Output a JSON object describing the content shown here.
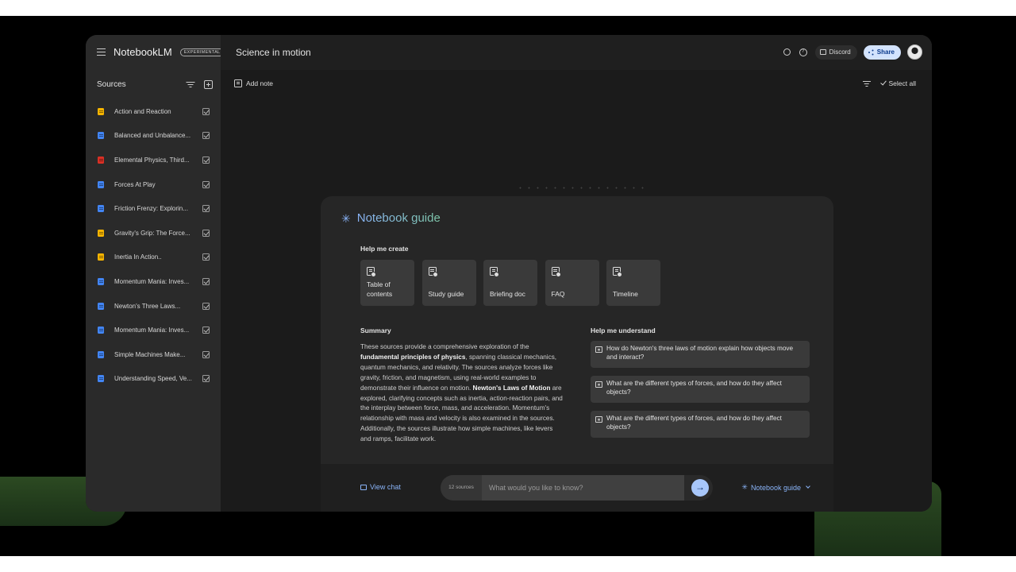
{
  "app": {
    "name": "NotebookLM",
    "badge": "EXPERIMENTAL"
  },
  "sidebar": {
    "title": "Sources",
    "items": [
      {
        "label": "Action and Reaction",
        "icon": "slides-icon",
        "color": "#f6b400",
        "checked": true
      },
      {
        "label": "Balanced and Unbalance...",
        "icon": "doc-icon",
        "color": "#4285f4",
        "checked": true
      },
      {
        "label": "Elemental Physics, Third...",
        "icon": "pdf-icon",
        "color": "#d93025",
        "checked": true
      },
      {
        "label": "Forces At Play",
        "icon": "doc-icon",
        "color": "#4285f4",
        "checked": true
      },
      {
        "label": "Friction Frenzy: Explorin...",
        "icon": "doc-icon",
        "color": "#4285f4",
        "checked": true
      },
      {
        "label": "Gravity's Grip: The Force...",
        "icon": "slides-icon",
        "color": "#f6b400",
        "checked": true
      },
      {
        "label": "Inertia In Action..",
        "icon": "slides-icon",
        "color": "#f6b400",
        "checked": true
      },
      {
        "label": "Momentum Mania: Inves...",
        "icon": "doc-icon",
        "color": "#4285f4",
        "checked": true
      },
      {
        "label": "Newton's Three Laws...",
        "icon": "doc-icon",
        "color": "#4285f4",
        "checked": true
      },
      {
        "label": "Momentum Mania: Inves...",
        "icon": "doc-icon",
        "color": "#4285f4",
        "checked": true
      },
      {
        "label": "Simple Machines Make...",
        "icon": "doc-icon",
        "color": "#4285f4",
        "checked": true
      },
      {
        "label": "Understanding Speed, Ve...",
        "icon": "doc-icon",
        "color": "#4285f4",
        "checked": true
      }
    ]
  },
  "header": {
    "title": "Science in motion",
    "discord_label": "Discord",
    "share_label": "Share"
  },
  "main": {
    "add_note_label": "Add note",
    "select_all_label": "Select all"
  },
  "guide": {
    "title": "Notebook guide",
    "create_label": "Help me create",
    "cards": [
      {
        "label": "Table of contents"
      },
      {
        "label": "Study guide"
      },
      {
        "label": "Briefing doc"
      },
      {
        "label": "FAQ"
      },
      {
        "label": "Timeline"
      }
    ],
    "summary_label": "Summary",
    "summary": {
      "p1": "These sources provide a comprehensive exploration of the ",
      "b1": "fundamental principles of physics",
      "p2": ", spanning classical mechanics, quantum mechanics, and relativity. The sources analyze forces like gravity, friction, and magnetism, using real-world examples to demonstrate their influence on motion. ",
      "b2": "Newton's Laws of Motion",
      "p3": " are explored, clarifying concepts such as inertia, action-reaction pairs, and the interplay between force, mass, and acceleration. Momentum's relationship with mass and velocity is also examined in the sources. Additionally, the sources illustrate how simple machines, like levers and ramps, facilitate work."
    },
    "understand_label": "Help me understand",
    "questions": [
      {
        "text": "How do Newton's three laws of motion explain how objects move and interact?"
      },
      {
        "text": "What are the different types of forces, and how do they affect objects?"
      },
      {
        "text": "What are the different types of forces, and how do they affect objects?"
      }
    ]
  },
  "footer": {
    "view_chat_label": "View chat",
    "sources_count": "12 sources",
    "input_placeholder": "What would you like to know?",
    "guide_toggle_label": "Notebook guide"
  },
  "colors": {
    "accent": "#8ab4f8",
    "share_bg": "#d3e3fd",
    "send_bg": "#a8c7fa"
  }
}
